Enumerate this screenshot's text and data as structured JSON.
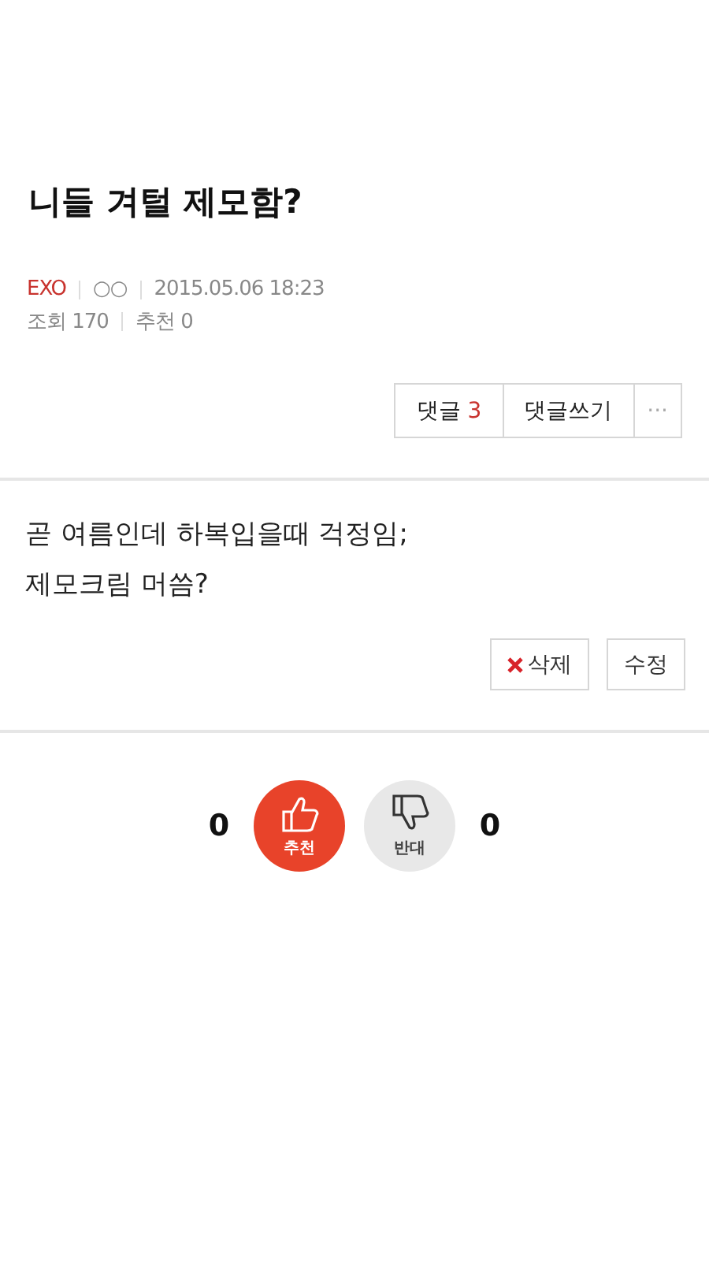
{
  "post": {
    "title": "니들 겨털 제모함?",
    "author": "EXO",
    "nickname": "○○",
    "date": "2015.05.06 18:23",
    "views": "조회 170",
    "recommends": "추천 0"
  },
  "actions": [
    {
      "kind": "comments",
      "label": "댓글",
      "count": "3"
    },
    {
      "kind": "write",
      "label": "댓글쓰기"
    },
    {
      "kind": "more",
      "label": "···"
    }
  ],
  "body": [
    "곧 여름인데 하복입을때 걱정임;",
    "제모크림 머씀?"
  ],
  "post_buttons": [
    {
      "kind": "delete",
      "label": "삭제"
    },
    {
      "kind": "edit",
      "label": "수정"
    }
  ],
  "votes": [
    {
      "kind": "up",
      "label": "추천",
      "count": "0"
    },
    {
      "kind": "down",
      "label": "반대",
      "count": "0"
    }
  ]
}
